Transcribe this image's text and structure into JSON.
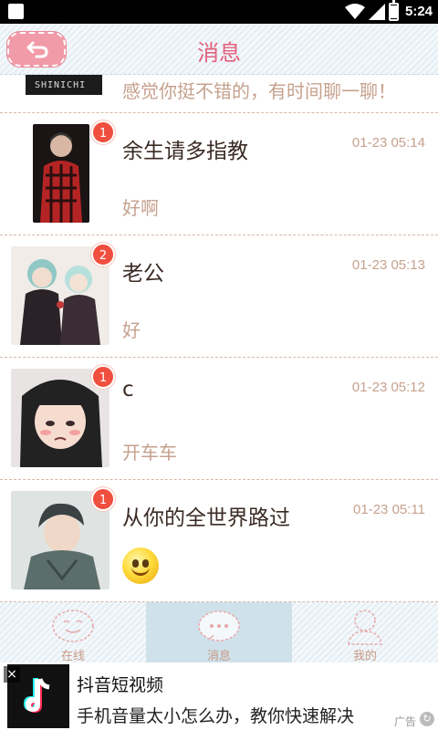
{
  "status_bar": {
    "time": "5:24"
  },
  "header": {
    "title": "消息"
  },
  "partial_item": {
    "avatar_text": "SHINICHI",
    "preview": "感觉你挺不错的，有时间聊一聊！"
  },
  "conversations": [
    {
      "name": "余生请多指教",
      "time": "01-23 05:14",
      "preview": "好啊",
      "badge": "1"
    },
    {
      "name": "老公",
      "time": "01-23 05:13",
      "preview": "好",
      "badge": "2"
    },
    {
      "name": "c",
      "time": "01-23 05:12",
      "preview": "开车车",
      "badge": "1"
    },
    {
      "name": "从你的全世界路过",
      "time": "01-23 05:11",
      "preview_icon": "smiley-emoji-icon",
      "badge": "1"
    }
  ],
  "bottom_nav": [
    {
      "label": "在线",
      "icon": "smiley-bubble-icon"
    },
    {
      "label": "消息",
      "icon": "message-bubble-icon"
    },
    {
      "label": "我的",
      "icon": "user-icon"
    }
  ],
  "ad": {
    "title": "抖音短视频",
    "description": "手机音量太小怎么办，教你快速解决",
    "tag": "广告",
    "close": "×",
    "refresh": "↻"
  },
  "colors": {
    "accent": "#e3607c",
    "muted": "#c6a18e",
    "badge": "#f04e3e"
  }
}
